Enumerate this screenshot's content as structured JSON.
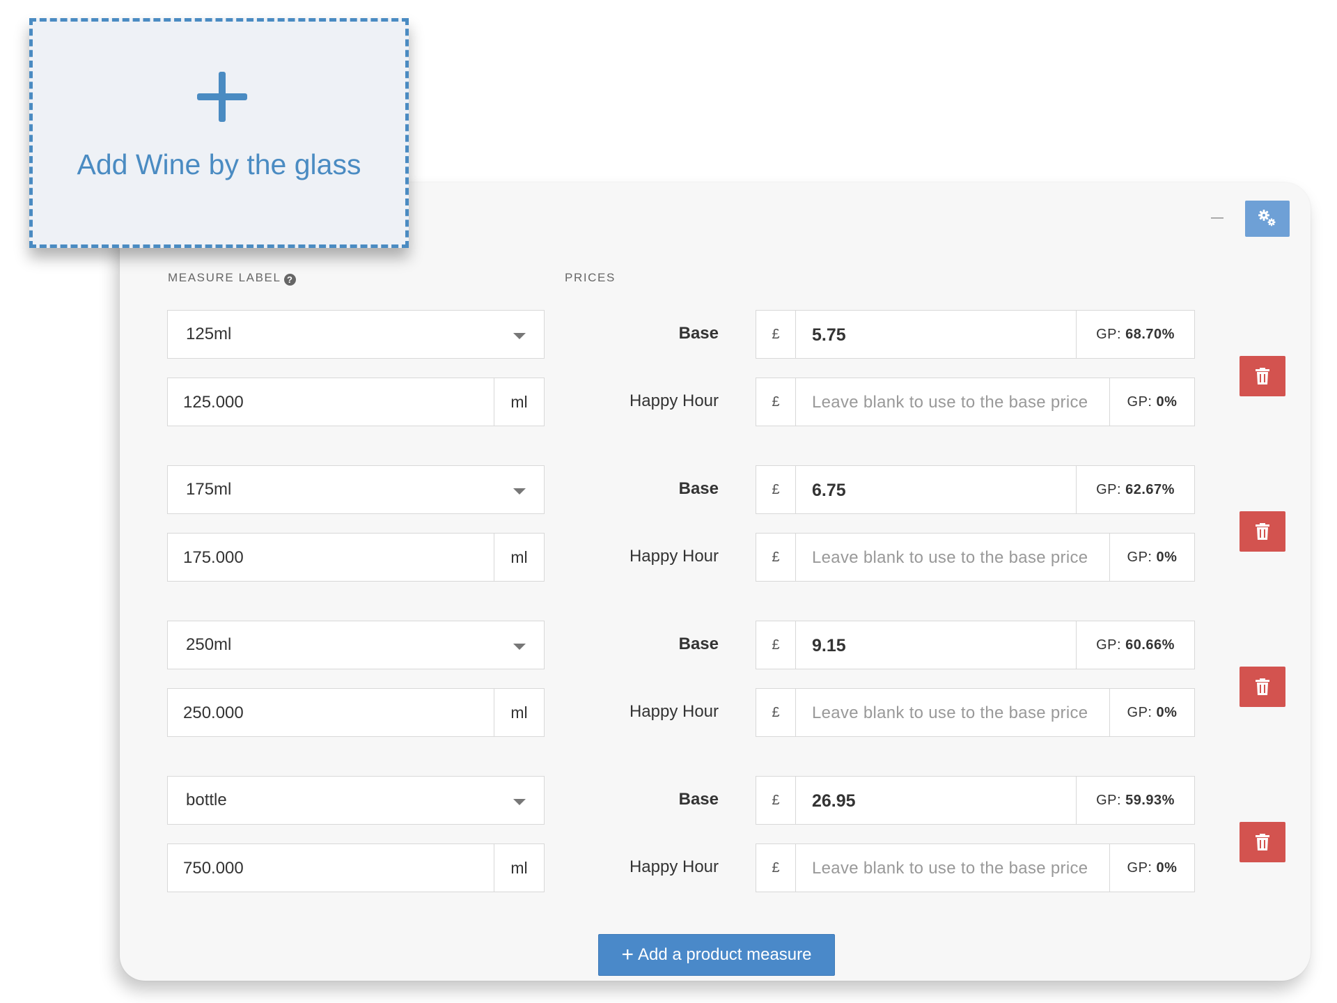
{
  "add_card": {
    "label": "Add Wine by the glass"
  },
  "columns": {
    "measure_label": "MEASURE LABEL",
    "prices": "PRICES"
  },
  "labels": {
    "base": "Base",
    "happy_hour": "Happy Hour",
    "currency": "£",
    "gp_prefix": "GP:"
  },
  "placeholders": {
    "happy_hour_price": "Leave blank to use to the base price"
  },
  "measures": [
    {
      "label": "125ml",
      "volume": "125.000",
      "unit": "ml",
      "base_price": "5.75",
      "base_gp": "68.70%",
      "hh_gp": "0%"
    },
    {
      "label": "175ml",
      "volume": "175.000",
      "unit": "ml",
      "base_price": "6.75",
      "base_gp": "62.67%",
      "hh_gp": "0%"
    },
    {
      "label": "250ml",
      "volume": "250.000",
      "unit": "ml",
      "base_price": "9.15",
      "base_gp": "60.66%",
      "hh_gp": "0%"
    },
    {
      "label": "bottle",
      "volume": "750.000",
      "unit": "ml",
      "base_price": "26.95",
      "base_gp": "59.93%",
      "hh_gp": "0%"
    }
  ],
  "actions": {
    "add_measure": "Add a product measure"
  },
  "icons": {
    "add": "plus-icon",
    "minimize": "minus-icon",
    "settings": "gears-icon",
    "help": "question-circle-icon",
    "delete": "trash-icon",
    "dropdown": "caret-down-icon"
  },
  "colors": {
    "accent": "#4a8bc2",
    "danger": "#d3534f",
    "settings": "#6ea0d6"
  }
}
